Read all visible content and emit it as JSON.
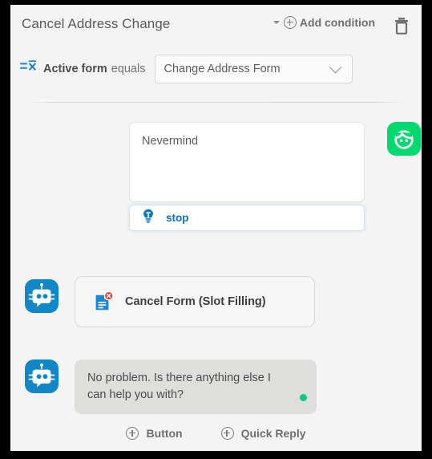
{
  "node": {
    "title": "Cancel Address Change",
    "add_condition_label": "Add condition",
    "delete_icon": "trash-icon",
    "add_condition_icon": "plus-circle-icon",
    "caret_icon": "caret-down-icon"
  },
  "condition": {
    "icon": "condition-form-icon",
    "variable": "Active form",
    "operator": "equals",
    "value": "Change Address Form",
    "chevron_icon": "chevron-down-icon"
  },
  "conversation": {
    "user_turn": {
      "utterance": "Nevermind",
      "intent": {
        "icon": "lightbulb-icon",
        "label": "stop"
      },
      "avatar_icon": "user-avatar-icon"
    },
    "bot_action_turn": {
      "avatar_icon": "bot-avatar-icon",
      "action_icon": "document-cancel-icon",
      "action_label": "Cancel Form (Slot Filling)"
    },
    "bot_message_turn": {
      "avatar_icon": "bot-avatar-icon",
      "text": "No problem. Is there anything else I can help you with?",
      "status_dot": "green-status-dot"
    }
  },
  "add_actions": [
    {
      "icon": "plus-circle-icon",
      "label": "Button"
    },
    {
      "icon": "plus-circle-icon",
      "label": "Quick Reply"
    }
  ],
  "colors": {
    "accent_blue": "#0b72bd",
    "user_avatar_green": "#00d96f",
    "bot_avatar_blue": "#1287c8",
    "status_green": "#00cf7f",
    "error_red": "#e8413c",
    "canvas": "#f4f4f4",
    "frame": "#000000"
  }
}
